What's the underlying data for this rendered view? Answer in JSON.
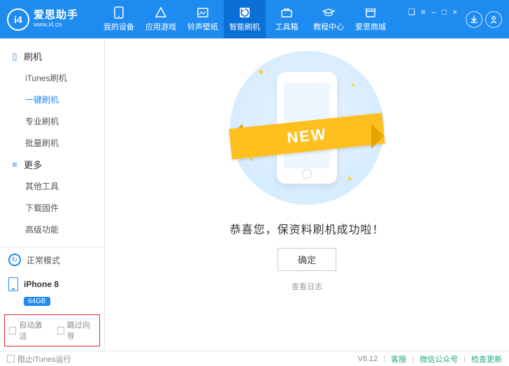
{
  "brand": {
    "name": "爱思助手",
    "url": "www.i4.cn",
    "logo_text": "i4"
  },
  "nav": [
    {
      "label": "我的设备"
    },
    {
      "label": "应用游戏"
    },
    {
      "label": "铃声壁纸"
    },
    {
      "label": "智能刷机"
    },
    {
      "label": "工具箱"
    },
    {
      "label": "教程中心"
    },
    {
      "label": "爱思商城"
    }
  ],
  "nav_active_index": 3,
  "sidebar": {
    "groups": [
      {
        "title": "刷机",
        "items": [
          "iTunes刷机",
          "一键刷机",
          "专业刷机",
          "批量刷机"
        ],
        "active_index": 1
      },
      {
        "title": "更多",
        "items": [
          "其他工具",
          "下载固件",
          "高级功能"
        ],
        "active_index": -1
      }
    ],
    "mode_label": "正常模式",
    "device": {
      "name": "iPhone 8",
      "storage": "64GB"
    },
    "checkboxes": {
      "auto_activate": "自动激活",
      "skip_guide": "跳过向导"
    }
  },
  "main": {
    "ribbon_text": "NEW",
    "success_text": "恭喜您，保资料刷机成功啦！",
    "ok_label": "确定",
    "log_link": "查看日志"
  },
  "statusbar": {
    "block_itunes": "阻止iTunes运行",
    "version": "V8.12",
    "links": [
      "客服",
      "微信公众号",
      "检查更新"
    ]
  },
  "colors": {
    "primary": "#1e8bf1",
    "ribbon": "#ffbf1f"
  }
}
